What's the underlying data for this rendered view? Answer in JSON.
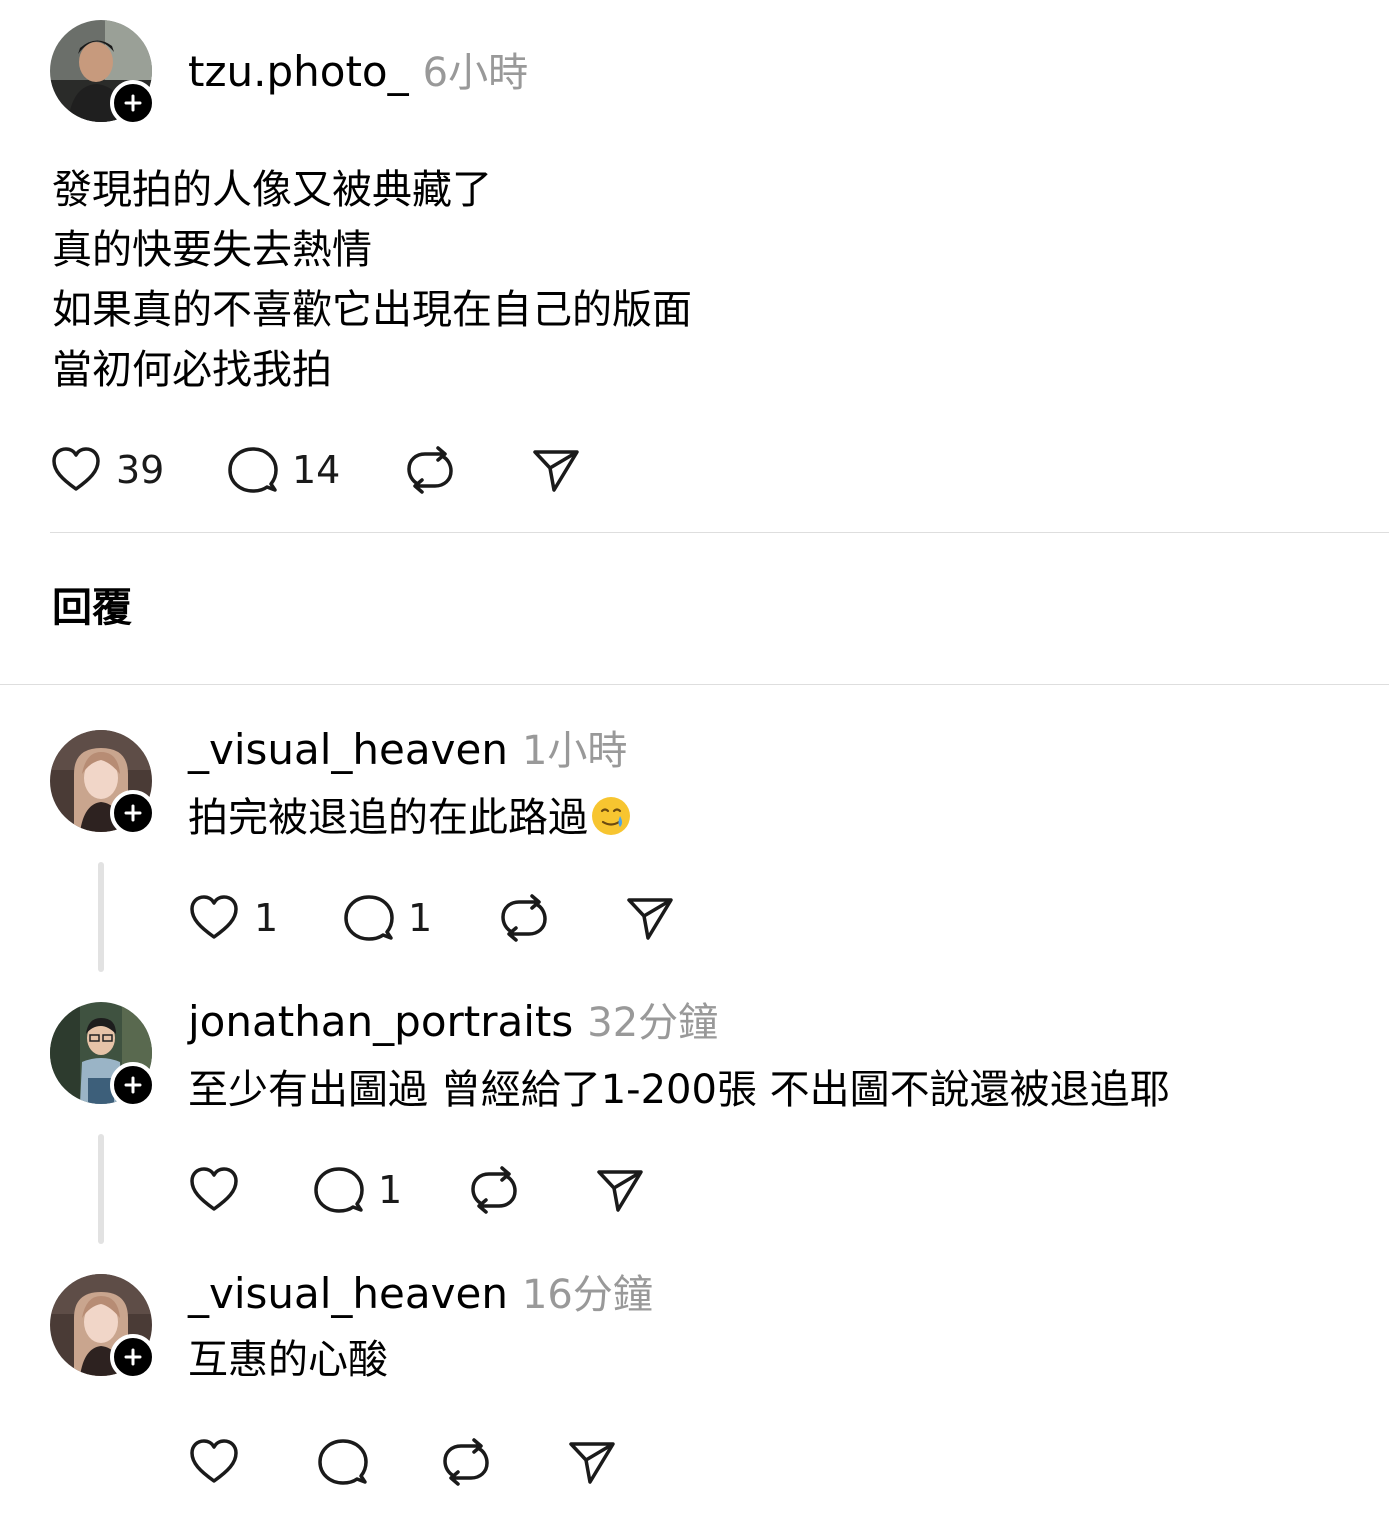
{
  "post": {
    "username": "tzu.photo_",
    "time": "6小時",
    "lines": [
      "發現拍的人像又被典藏了",
      "真的快要失去熱情",
      "如果真的不喜歡它出現在自己的版面",
      "當初何必找我拍"
    ],
    "likes": "39",
    "comments": "14"
  },
  "replies_heading": "回覆",
  "replies": [
    {
      "username": "_visual_heaven",
      "time": "1小時",
      "text": "拍完被退追的在此路過",
      "emoji": "face-holding-back-tears",
      "likes": "1",
      "comments": "1"
    },
    {
      "username": "jonathan_portraits",
      "time": "32分鐘",
      "text": "至少有出圖過 曾經給了1-200張 不出圖不說還被退追耶",
      "likes": "",
      "comments": "1"
    },
    {
      "username": "_visual_heaven",
      "time": "16分鐘",
      "text": "互惠的心酸",
      "likes": "",
      "comments": ""
    }
  ]
}
